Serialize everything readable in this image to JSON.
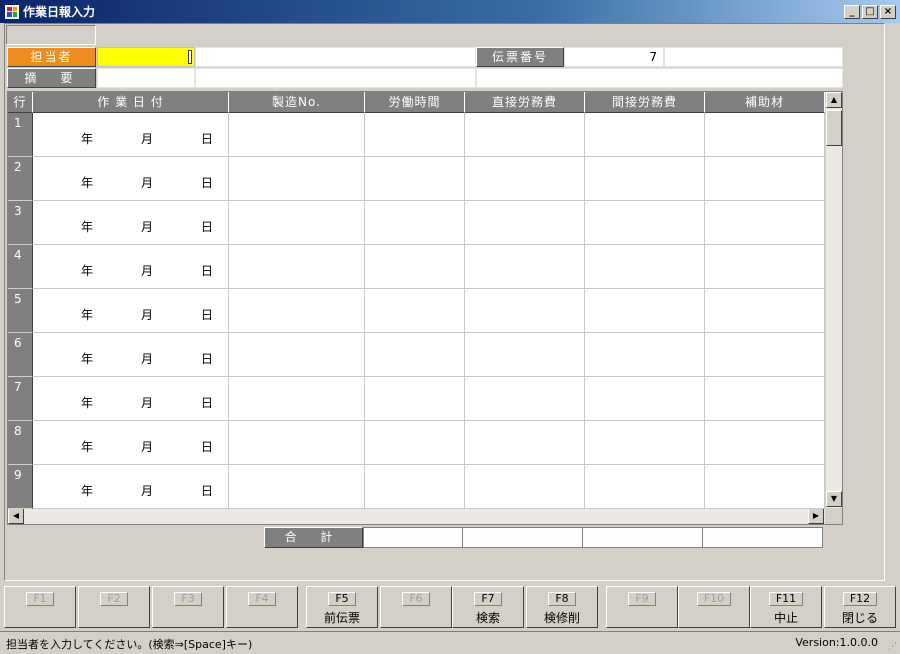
{
  "window": {
    "title": "作業日報入力",
    "min_glyph": "_",
    "max_glyph": "□",
    "close_glyph": "×"
  },
  "header": {
    "tanto_label": "担当者",
    "tanto_value": "",
    "tekiyo_label": "摘　要",
    "denpyo_label": "伝票番号",
    "denpyo_value": "7"
  },
  "grid": {
    "columns": [
      "行",
      "作 業 日 付",
      "製造No.",
      "労働時間",
      "直接労務費",
      "間接労務費",
      "補助材"
    ],
    "date_parts": [
      "年",
      "月",
      "日"
    ],
    "rows": [
      "1",
      "2",
      "3",
      "4",
      "5",
      "6",
      "7",
      "8",
      "9"
    ]
  },
  "totals": {
    "label": "合 計"
  },
  "fkeys": [
    {
      "key": "F1",
      "action": "",
      "enabled": false
    },
    {
      "key": "F2",
      "action": "",
      "enabled": false
    },
    {
      "key": "F3",
      "action": "",
      "enabled": false
    },
    {
      "key": "F4",
      "action": "",
      "enabled": false
    },
    {
      "key": "F5",
      "action": "前伝票",
      "enabled": true
    },
    {
      "key": "F6",
      "action": "",
      "enabled": false
    },
    {
      "key": "F7",
      "action": "検索",
      "enabled": true
    },
    {
      "key": "F8",
      "action": "検修削",
      "enabled": true
    },
    {
      "key": "F9",
      "action": "",
      "enabled": false
    },
    {
      "key": "F10",
      "action": "",
      "enabled": false
    },
    {
      "key": "F11",
      "action": "中止",
      "enabled": true
    },
    {
      "key": "F12",
      "action": "閉じる",
      "enabled": true
    }
  ],
  "status": {
    "message": "担当者を入力してください。(検索⇒[Space]キー)",
    "version": "Version:1.0.0.0"
  },
  "colors": {
    "accent_label": "#f08c1e",
    "focused_field": "#ffff00",
    "title_bar": "#0a246a"
  }
}
